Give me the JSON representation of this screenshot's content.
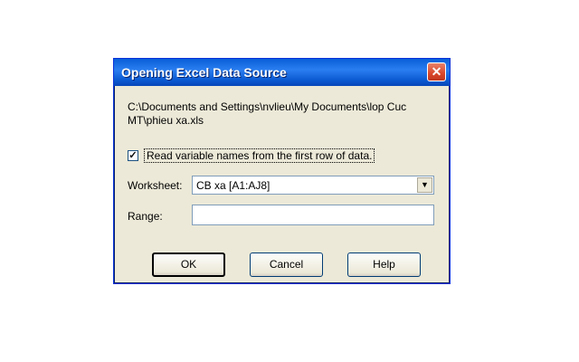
{
  "dialog": {
    "title": "Opening Excel Data Source",
    "close_glyph": "✕",
    "path_line1": "C:\\Documents and Settings\\nvlieu\\My Documents\\lop Cuc",
    "path_line2": "MT\\phieu xa.xls",
    "checkbox_checked_glyph": "✓",
    "checkbox_label": "Read variable names from the first row of data.",
    "worksheet_label": "Worksheet:",
    "worksheet_value": "CB xa  [A1:AJ8]",
    "dropdown_glyph": "▼",
    "range_label": "Range:",
    "range_value": "",
    "buttons": {
      "ok": "OK",
      "cancel": "Cancel",
      "help": "Help"
    }
  },
  "colors": {
    "titlebar": "#0a5fd8",
    "dialog_bg": "#ece9d8",
    "close_button": "#d9462a"
  }
}
